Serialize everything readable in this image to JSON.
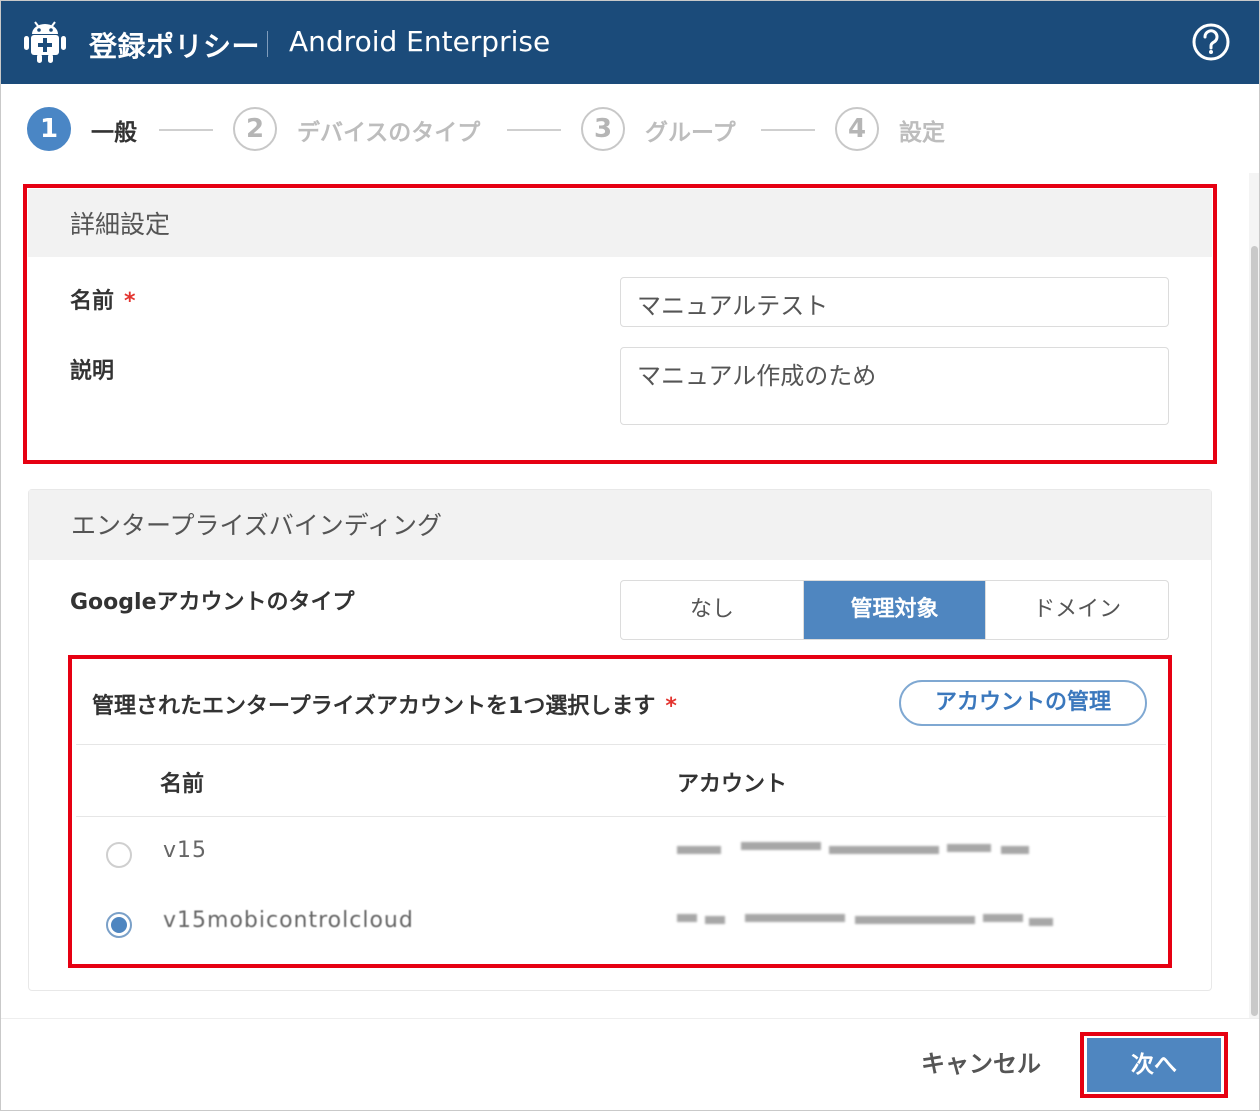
{
  "header": {
    "title": "登録ポリシー",
    "subtitle": "Android Enterprise",
    "icons": {
      "logo": "android-plus-icon",
      "help": "question-circle-icon"
    }
  },
  "stepper": {
    "steps": [
      {
        "number": "1",
        "label": "一般",
        "active": true
      },
      {
        "number": "2",
        "label": "デバイスのタイプ",
        "active": false
      },
      {
        "number": "3",
        "label": "グループ",
        "active": false
      },
      {
        "number": "4",
        "label": "設定",
        "active": false
      }
    ]
  },
  "details": {
    "heading": "詳細設定",
    "name_label": "名前",
    "required_mark": "*",
    "name_value": "マニュアルテスト",
    "description_label": "説明",
    "description_value": "マニュアル作成のため"
  },
  "binding": {
    "heading": "エンタープライズバインディング",
    "account_type_label": "Googleアカウントのタイプ",
    "account_type_options": [
      "なし",
      "管理対象",
      "ドメイン"
    ],
    "selected_option": "管理対象",
    "select_prompt": "管理されたエンタープライズアカウントを1つ選択します",
    "manage_button": "アカウントの管理",
    "table": {
      "col_name": "名前",
      "col_account": "アカウント",
      "rows": [
        {
          "name": "v15",
          "selected": false
        },
        {
          "name": "v15mobicontrolcloud",
          "selected": true
        }
      ]
    }
  },
  "footer": {
    "cancel_label": "キャンセル",
    "next_label": "次へ"
  },
  "colors": {
    "header_bg": "#1b4b7a",
    "accent": "#4f86c0",
    "highlight_border": "#e60012",
    "required": "#e3342f"
  }
}
